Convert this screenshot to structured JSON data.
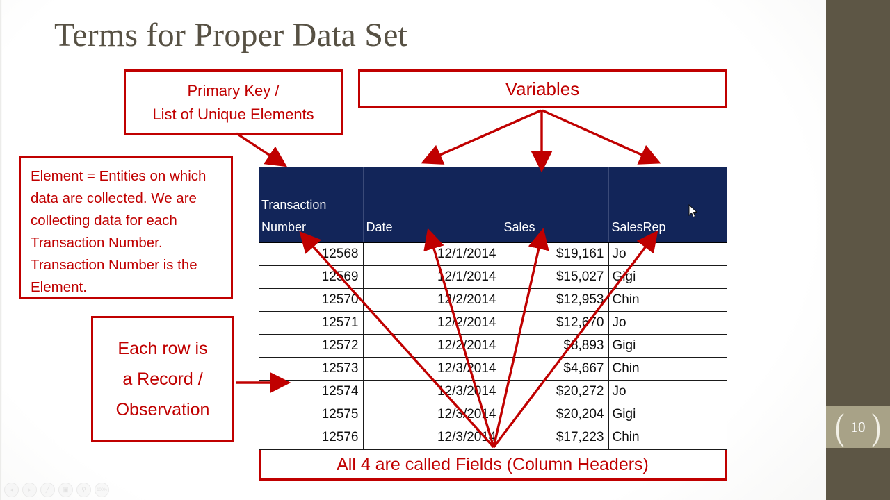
{
  "slide": {
    "title": "Terms for Proper Data Set",
    "page_number": "10",
    "accent_color": "#c00000",
    "header_color": "#122559",
    "title_color": "#575144",
    "sidebar_color": "#5d5645",
    "badge_color": "#a8a287"
  },
  "callouts": {
    "primary_key": {
      "line1": "Primary Key /",
      "line2": "List of Unique Elements"
    },
    "variables": {
      "label": "Variables"
    },
    "element": {
      "text": "Element = Entities on which data are collected. We are collecting data for each Transaction Number. Transaction Number is the Element."
    },
    "record": {
      "line1": "Each row is",
      "line2": "a Record /",
      "line3": "Observation"
    },
    "fields": {
      "label": "All 4 are called Fields (Column Headers)"
    }
  },
  "table": {
    "headers": [
      {
        "line1": "Transaction",
        "line2": "Number"
      },
      {
        "line1": "",
        "line2": "Date"
      },
      {
        "line1": "",
        "line2": "Sales"
      },
      {
        "line1": "",
        "line2": "SalesRep"
      }
    ],
    "rows": [
      {
        "transaction_number": "12568",
        "date": "12/1/2014",
        "sales": "$19,161",
        "salesrep": "Jo"
      },
      {
        "transaction_number": "12569",
        "date": "12/1/2014",
        "sales": "$15,027",
        "salesrep": "Gigi"
      },
      {
        "transaction_number": "12570",
        "date": "12/2/2014",
        "sales": "$12,953",
        "salesrep": "Chin"
      },
      {
        "transaction_number": "12571",
        "date": "12/2/2014",
        "sales": "$12,670",
        "salesrep": "Jo"
      },
      {
        "transaction_number": "12572",
        "date": "12/2/2014",
        "sales": "$8,893",
        "salesrep": "Gigi"
      },
      {
        "transaction_number": "12573",
        "date": "12/3/2014",
        "sales": "$4,667",
        "salesrep": "Chin"
      },
      {
        "transaction_number": "12574",
        "date": "12/3/2014",
        "sales": "$20,272",
        "salesrep": "Jo"
      },
      {
        "transaction_number": "12575",
        "date": "12/3/2014",
        "sales": "$20,204",
        "salesrep": "Gigi"
      },
      {
        "transaction_number": "12576",
        "date": "12/3/2014",
        "sales": "$17,223",
        "salesrep": "Chin"
      }
    ]
  },
  "player_toolbar": {
    "buttons": [
      {
        "name": "previous-icon",
        "glyph": "◂"
      },
      {
        "name": "play-icon",
        "glyph": "▸"
      },
      {
        "name": "pen-icon",
        "glyph": "╱"
      },
      {
        "name": "copy-icon",
        "glyph": "▣"
      },
      {
        "name": "search-icon",
        "glyph": "⚲"
      },
      {
        "name": "zoom-level-icon",
        "glyph": "100%"
      }
    ]
  }
}
